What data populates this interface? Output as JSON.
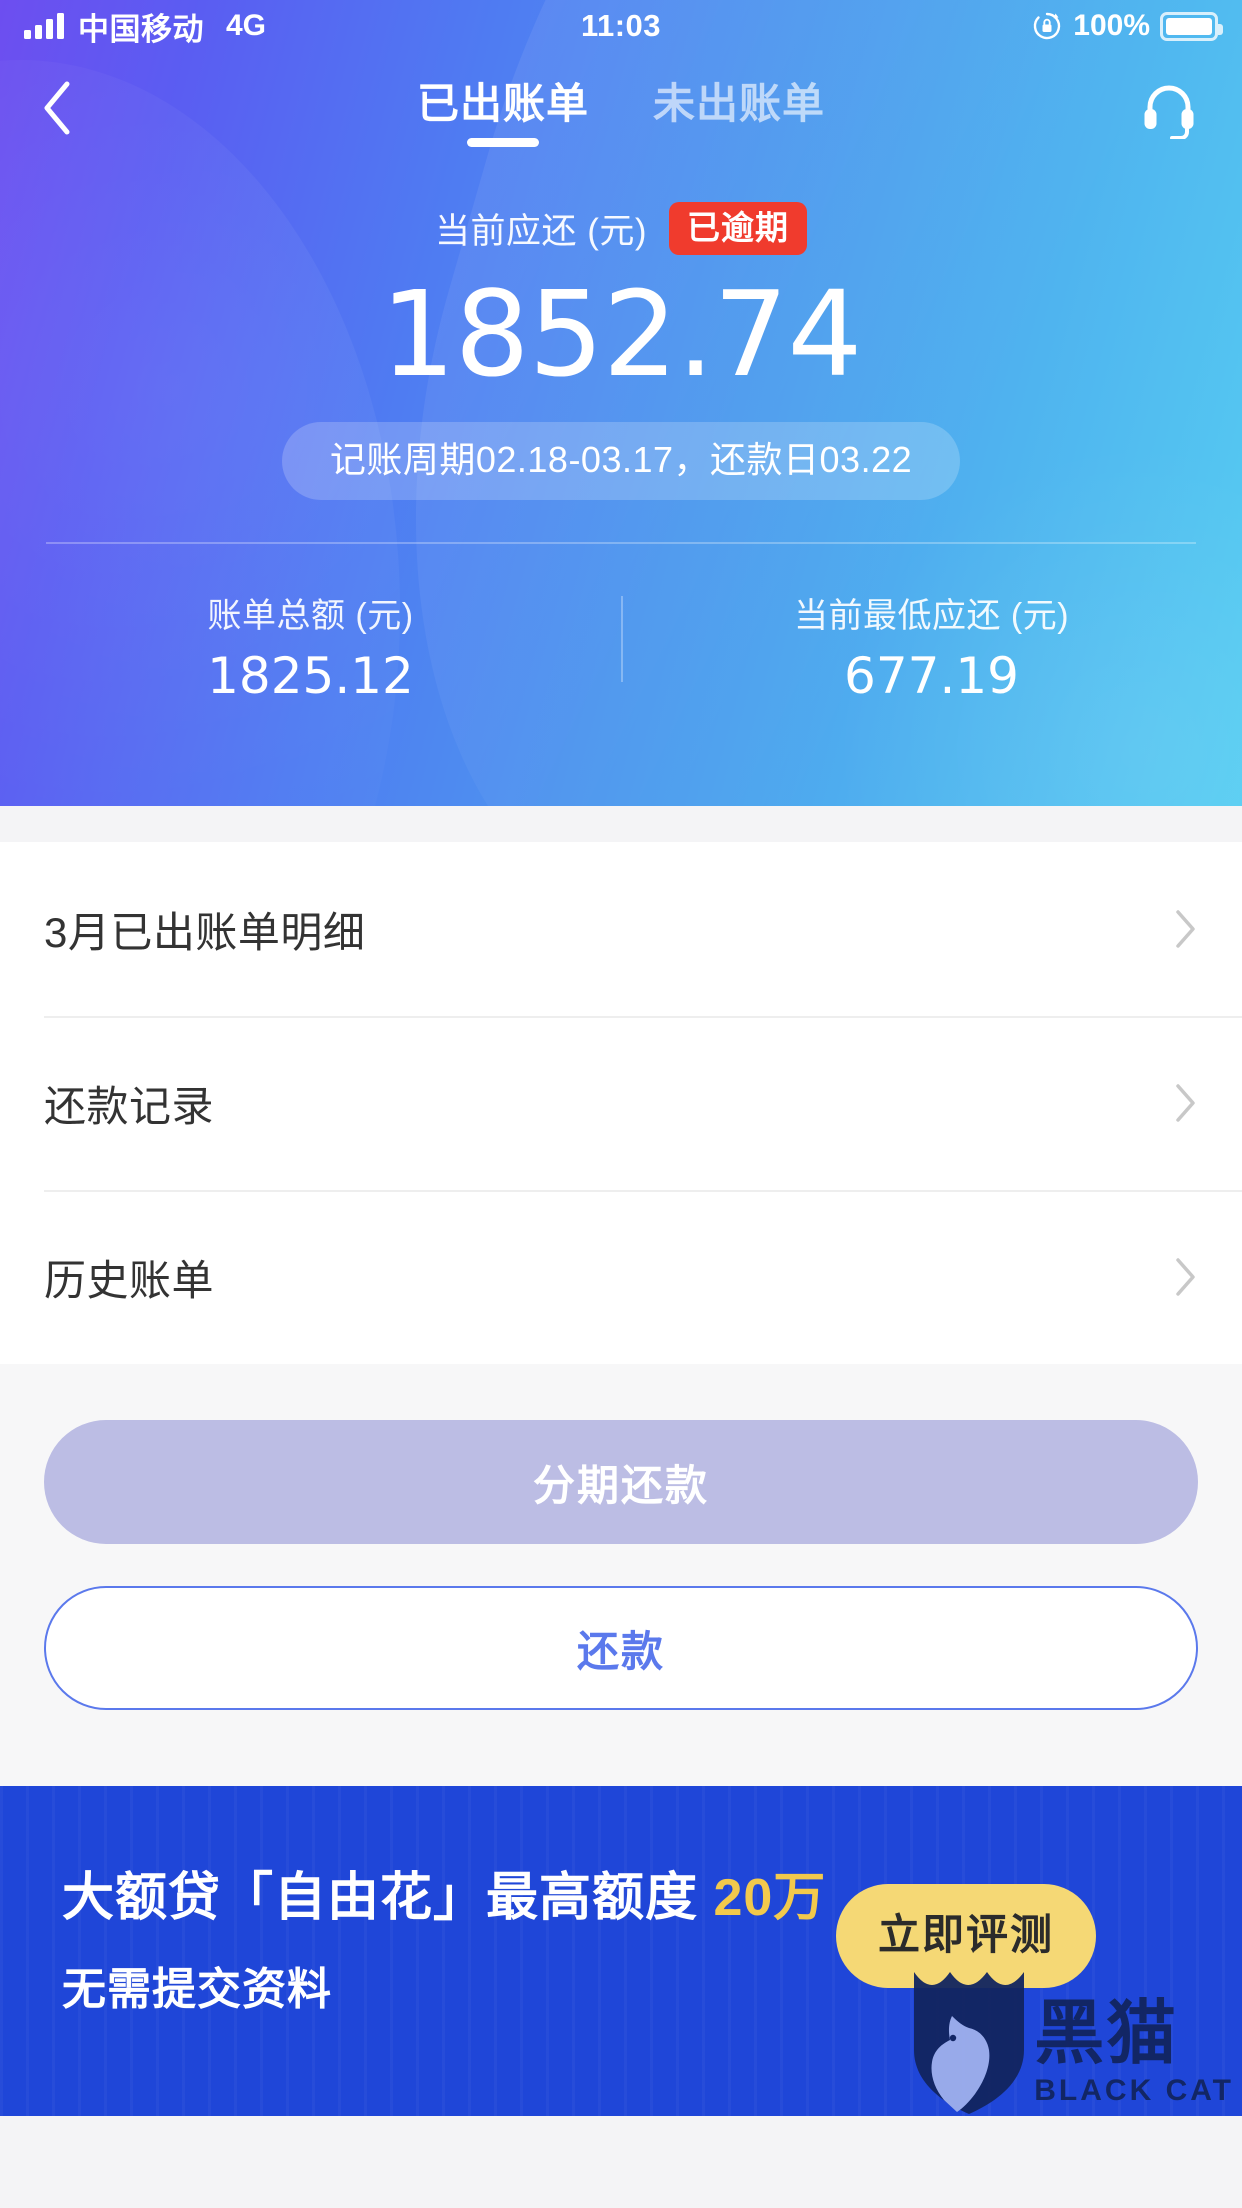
{
  "status_bar": {
    "carrier": "中国移动",
    "network": "4G",
    "time": "11:03",
    "battery_percent": "100%",
    "signal_icon": "signal-bars-icon",
    "rotation_lock_icon": "rotation-lock-icon",
    "battery_icon": "battery-full-icon"
  },
  "nav": {
    "back_icon": "back-chevron-icon",
    "service_icon": "headset-icon",
    "tabs": [
      {
        "label": "已出账单",
        "active": true
      },
      {
        "label": "未出账单",
        "active": false
      }
    ]
  },
  "hero": {
    "due_label": "当前应还 (元)",
    "overdue_badge": "已逾期",
    "due_amount": "1852.74",
    "cycle_text": "记账周期02.18-03.17，还款日03.22",
    "stats": [
      {
        "label": "账单总额 (元)",
        "value": "1825.12"
      },
      {
        "label": "当前最低应还 (元)",
        "value": "677.19"
      }
    ]
  },
  "menu": {
    "arrow_icon": "chevron-right-icon",
    "rows": [
      {
        "label": "3月已出账单明细"
      },
      {
        "label": "还款记录"
      },
      {
        "label": "历史账单"
      }
    ]
  },
  "actions": {
    "installment_label": "分期还款",
    "repay_label": "还款"
  },
  "banner": {
    "title_prefix": "大额贷「自由花」最高额度 ",
    "title_highlight": "20万",
    "subtitle": "无需提交资料",
    "cta_label": "立即评测",
    "watermark_cn": "黑猫",
    "watermark_en": "BLACK CAT",
    "watermark_icon": "black-cat-shield-icon"
  },
  "colors": {
    "gradient_start": "#6d4ef0",
    "gradient_end": "#56cdf2",
    "overdue_red": "#f03b2d",
    "primary_blue": "#5b79ec",
    "disabled_lavender": "#bcbde4",
    "banner_blue": "#1f46d8",
    "banner_gold": "#f2c94c",
    "cta_yellow": "#f5d875"
  }
}
